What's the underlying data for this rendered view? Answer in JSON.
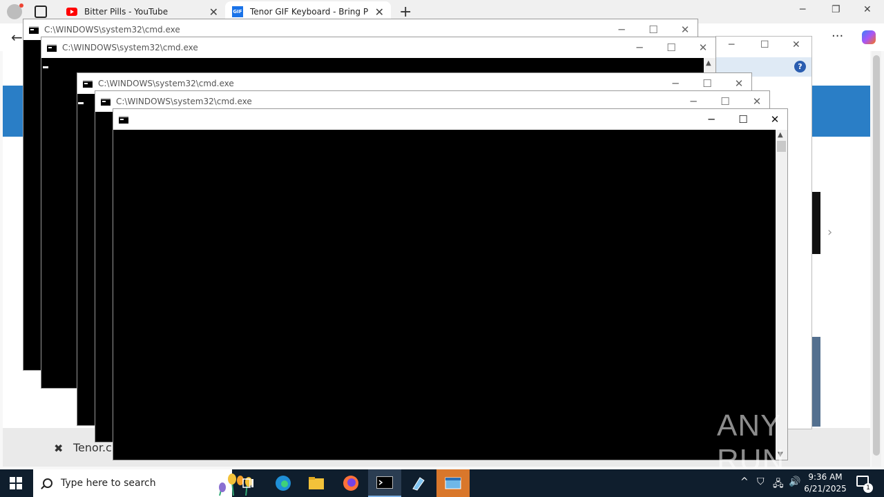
{
  "browser": {
    "tabs": [
      {
        "title": "Bitter Pills - YouTube",
        "icon": "youtube-icon"
      },
      {
        "title": "Tenor GIF Keyboard - Bring Perso",
        "icon": "tenor-gif-icon"
      }
    ],
    "footer_text": "Tenor.c"
  },
  "windows": [
    {
      "title": "C:\\WINDOWS\\system32\\cmd.exe"
    },
    {
      "title": "C:\\WINDOWS\\system32\\cmd.exe"
    },
    {
      "title": "C:\\WINDOWS\\system32\\cmd.exe"
    },
    {
      "title": "C:\\WINDOWS\\system32\\cmd.exe"
    },
    {
      "title": ""
    }
  ],
  "taskbar": {
    "search_placeholder": "Type here to search",
    "time": "9:36 AM",
    "date": "6/21/2025",
    "notification_count": "1"
  },
  "watermark": {
    "text": "ANY RUN"
  },
  "colors": {
    "taskbar": "#0f1e2d",
    "accent_blue": "#2a7ec6",
    "console_bg": "#000000"
  }
}
